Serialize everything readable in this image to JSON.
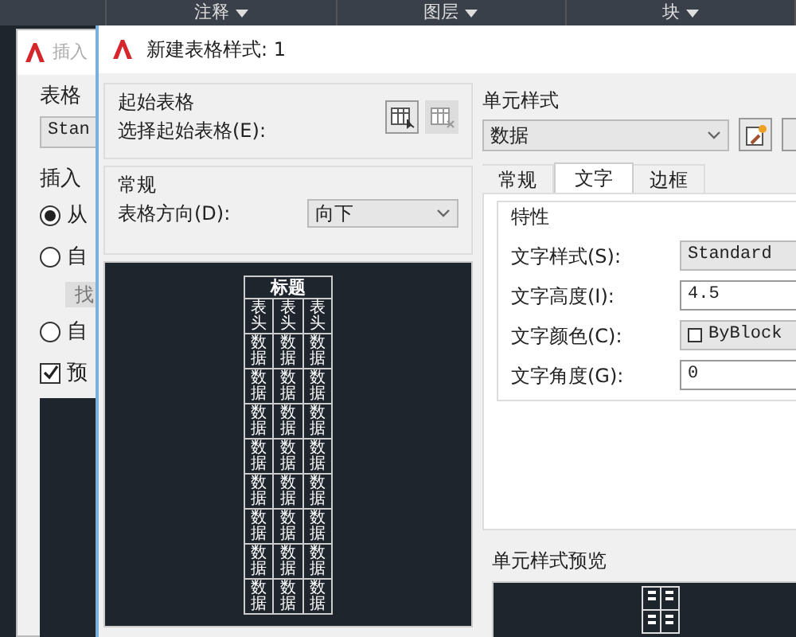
{
  "ribbon": {
    "items": [
      {
        "label": "注释"
      },
      {
        "label": "图层"
      },
      {
        "label": "块"
      }
    ]
  },
  "back_dialog": {
    "title": "插入",
    "style_label": "表格",
    "style_value": "Stan",
    "insert_label": "插入",
    "controls": [
      {
        "kind": "radio",
        "label": "从",
        "selected": true
      },
      {
        "kind": "radio",
        "label": "自",
        "selected": false
      },
      {
        "kind": "button",
        "label": "找"
      },
      {
        "kind": "radio",
        "label": "自",
        "selected": false
      },
      {
        "kind": "checkbox",
        "label": "预",
        "checked": true
      }
    ]
  },
  "dialog": {
    "title": "新建表格样式: 1",
    "starting_table": {
      "legend": "起始表格",
      "label": "选择起始表格(E):"
    },
    "general": {
      "legend": "常规",
      "direction_label": "表格方向(D):",
      "direction_value": "向下"
    },
    "preview": {
      "title": "标题",
      "rows": [
        {
          "cells": [
            "表头",
            "表头",
            "表头"
          ]
        },
        {
          "cells": [
            "数据",
            "数据",
            "数据"
          ]
        },
        {
          "cells": [
            "数据",
            "数据",
            "数据"
          ]
        },
        {
          "cells": [
            "数据",
            "数据",
            "数据"
          ]
        },
        {
          "cells": [
            "数据",
            "数据",
            "数据"
          ]
        },
        {
          "cells": [
            "数据",
            "数据",
            "数据"
          ]
        },
        {
          "cells": [
            "数据",
            "数据",
            "数据"
          ]
        },
        {
          "cells": [
            "数据",
            "数据",
            "数据"
          ]
        },
        {
          "cells": [
            "数据",
            "数据",
            "数据"
          ]
        }
      ]
    },
    "cell_style": {
      "label": "单元样式",
      "value": "数据",
      "tabs": [
        {
          "label": "常规",
          "selected": false
        },
        {
          "label": "文字",
          "selected": true
        },
        {
          "label": "边框",
          "selected": false
        }
      ],
      "group": "特性",
      "fields": [
        {
          "kind": "select",
          "label": "文字样式(S):",
          "value": "Standard"
        },
        {
          "kind": "input",
          "label": "文字高度(I):",
          "value": "4.5"
        },
        {
          "kind": "color",
          "label": "文字颜色(C):",
          "value": "ByBlock"
        },
        {
          "kind": "input",
          "label": "文字角度(G):",
          "value": "0"
        }
      ],
      "preview_label": "单元样式预览"
    }
  }
}
